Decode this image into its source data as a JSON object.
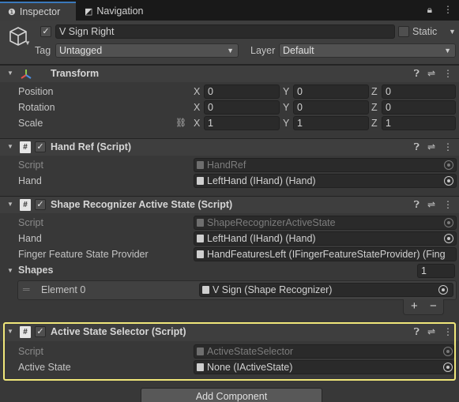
{
  "tabs": [
    {
      "label": "Inspector",
      "icon": "info-icon",
      "active": true
    },
    {
      "label": "Navigation",
      "icon": "navigation-icon",
      "active": false
    }
  ],
  "gameobject": {
    "name": "V Sign Right",
    "active": true,
    "static_label": "Static",
    "tag_label": "Tag",
    "tag_value": "Untagged",
    "layer_label": "Layer",
    "layer_value": "Default"
  },
  "transform": {
    "title": "Transform",
    "rows": [
      {
        "label": "Position",
        "x": "0",
        "y": "0",
        "z": "0"
      },
      {
        "label": "Rotation",
        "x": "0",
        "y": "0",
        "z": "0"
      },
      {
        "label": "Scale",
        "x": "1",
        "y": "1",
        "z": "1"
      }
    ],
    "axis": {
      "x": "X",
      "y": "Y",
      "z": "Z"
    }
  },
  "hand_ref": {
    "title": "Hand Ref (Script)",
    "script_label": "Script",
    "script_value": "HandRef",
    "hand_label": "Hand",
    "hand_value": "LeftHand (IHand) (Hand)"
  },
  "shape_recognizer": {
    "title": "Shape Recognizer Active State (Script)",
    "script_label": "Script",
    "script_value": "ShapeRecognizerActiveState",
    "hand_label": "Hand",
    "hand_value": "LeftHand (IHand) (Hand)",
    "provider_label": "Finger Feature State Provider",
    "provider_value": "HandFeaturesLeft (IFingerFeatureStateProvider) (Fing",
    "shapes_label": "Shapes",
    "shapes_count": "1",
    "element_label": "Element 0",
    "element_value": "V Sign (Shape Recognizer)",
    "add_label": "+",
    "remove_label": "−"
  },
  "active_state_selector": {
    "title": "Active State Selector (Script)",
    "script_label": "Script",
    "script_value": "ActiveStateSelector",
    "state_label": "Active State",
    "state_value": "None (IActiveState)"
  },
  "add_component_label": "Add Component",
  "colors": {
    "highlight": "#f0e77a",
    "tab_accent": "#3a79bb"
  }
}
